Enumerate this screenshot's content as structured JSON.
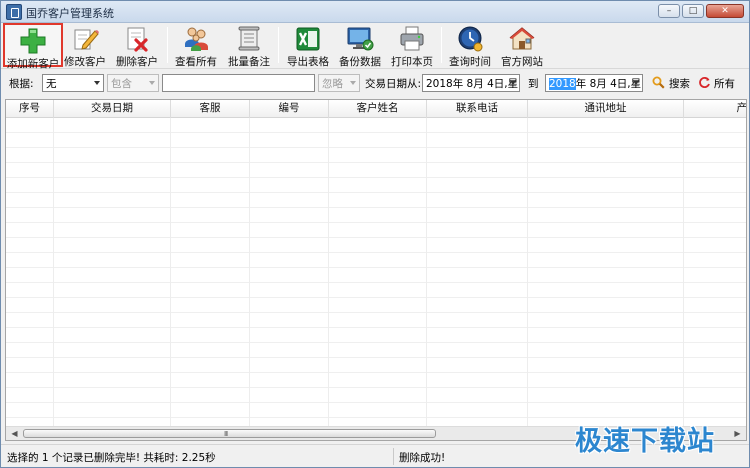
{
  "window": {
    "title": "国乔客户管理系统"
  },
  "toolbar": {
    "buttons": [
      {
        "label": "添加新客户",
        "icon": "add-plus-icon"
      },
      {
        "label": "修改客户",
        "icon": "edit-pencil-icon"
      },
      {
        "label": "删除客户",
        "icon": "delete-document-icon"
      },
      {
        "label": "查看所有",
        "icon": "users-group-icon"
      },
      {
        "label": "批量备注",
        "icon": "scroll-note-icon"
      },
      {
        "label": "导出表格",
        "icon": "excel-icon"
      },
      {
        "label": "备份数据",
        "icon": "monitor-backup-icon"
      },
      {
        "label": "打印本页",
        "icon": "printer-icon"
      },
      {
        "label": "查询时间",
        "icon": "clock-icon"
      },
      {
        "label": "官方网站",
        "icon": "home-icon"
      }
    ]
  },
  "search": {
    "basis_label": "根据:",
    "basis_value": "无",
    "match_value": "包含",
    "keyword_value": "",
    "ignore_value": "忽略",
    "date_from_label": "交易日期从:",
    "date_from_value": "2018年 8月 4日,星!",
    "date_to_label": "到",
    "date_to_year": "2018",
    "date_to_rest": "年 8月 4日,星!",
    "search_label": "搜索",
    "all_label": "所有"
  },
  "grid": {
    "columns": [
      "序号",
      "交易日期",
      "客服",
      "编号",
      "客户姓名",
      "联系电话",
      "通讯地址",
      "产"
    ],
    "rows": [],
    "scroll_grip": "III"
  },
  "status": {
    "left_text": "选择的 1 个记录已删除完毕! 共耗时: 2.25秒",
    "mid_text": "删除成功!"
  },
  "watermark": {
    "text": "极速下载站"
  },
  "colors": {
    "accent_blue": "#2c86cf",
    "selection_red": "#e0382c",
    "highlight": "#3399ff"
  }
}
